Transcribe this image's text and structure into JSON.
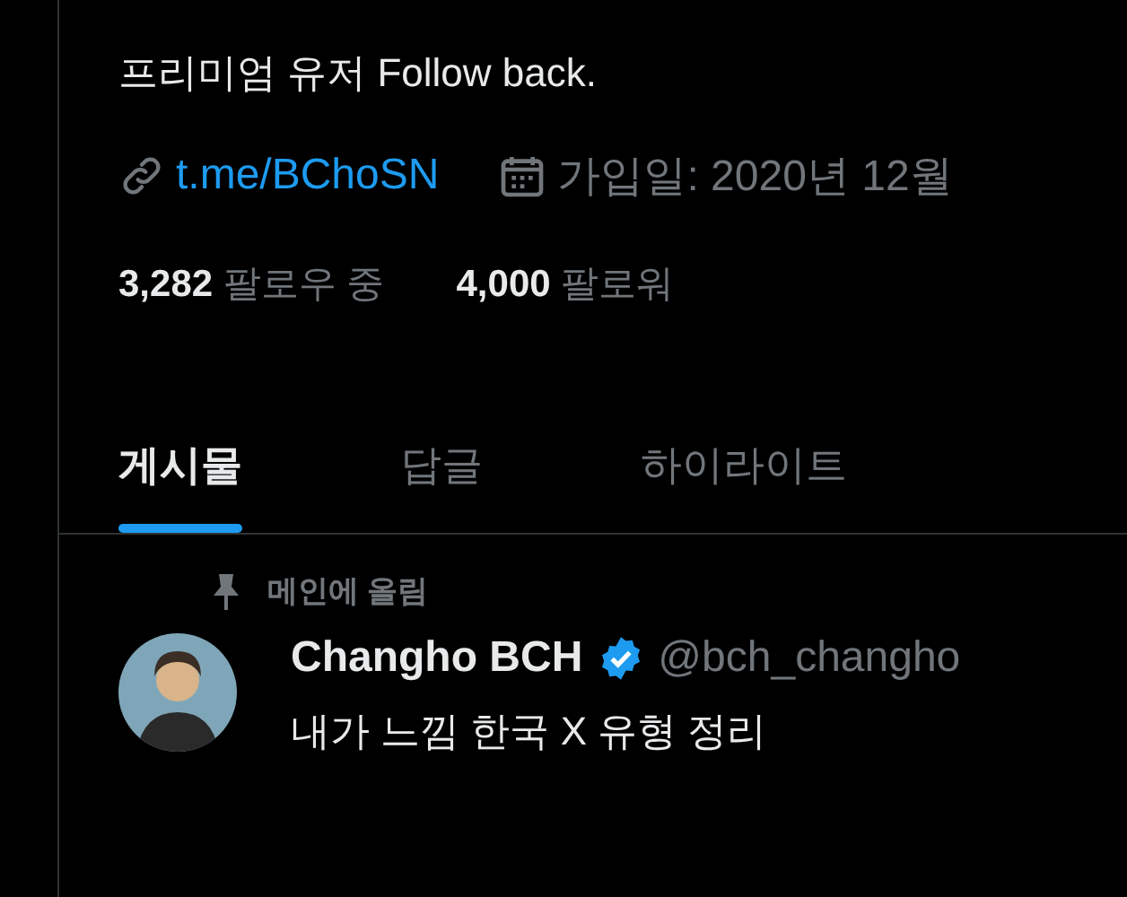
{
  "bio": "프리미엄 유저 Follow back.",
  "link": "t.me/BChoSN",
  "joined": "가입일: 2020년 12월",
  "stats": [
    {
      "count": "3,282",
      "label": "팔로우 중"
    },
    {
      "count": "4,000",
      "label": "팔로워"
    }
  ],
  "tabs": [
    {
      "label": "게시물",
      "selected": true
    },
    {
      "label": "답글",
      "selected": false
    },
    {
      "label": "하이라이트",
      "selected": false
    }
  ],
  "pinned_label": "메인에 올림",
  "post": {
    "name": "Changho BCH",
    "verified": true,
    "handle": "@bch_changho",
    "text": "내가 느낌 한국 X 유형 정리"
  }
}
